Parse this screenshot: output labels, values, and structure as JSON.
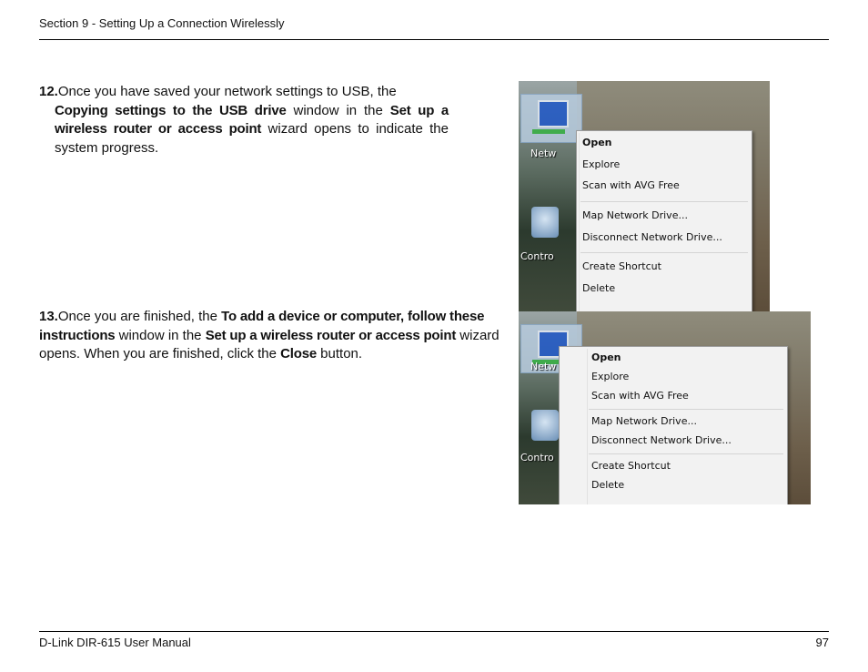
{
  "header": {
    "section_title": "Section 9 - Setting Up a Connection Wirelessly"
  },
  "footer": {
    "manual": "D-Link DIR-615 User Manual",
    "page": "97"
  },
  "step12": {
    "number": "12.",
    "t1": "Once you have saved your network settings to USB,  the",
    "b1": "Copying settings to the USB drive",
    "t2": " window in the ",
    "b2": "Set up a wireless router or access point",
    "t3": " wizard opens to indicate the system progress."
  },
  "step13": {
    "number": "13.",
    "t1": "Once you are finished, the ",
    "b1": "To add a device or computer, follow these instructions",
    "t2": " window in the ",
    "b2": "Set up a wireless router or access point",
    "t3": " wizard opens. When you are finished, click the ",
    "b3": "Close",
    "t4": " button."
  },
  "screenshot1": {
    "icon1_label": "Netw",
    "icon2_label": "Contro",
    "menu": [
      "Open",
      "Explore",
      "Scan with AVG Free",
      "Map Network Drive...",
      "Disconnect Network Drive...",
      "Create Shortcut",
      "Delete"
    ]
  },
  "screenshot2": {
    "icon1_label": "Netw",
    "icon2_label": "Contro",
    "menu": [
      "Open",
      "Explore",
      "Scan with AVG Free",
      "Map Network Drive...",
      "Disconnect Network Drive...",
      "Create Shortcut",
      "Delete"
    ]
  }
}
